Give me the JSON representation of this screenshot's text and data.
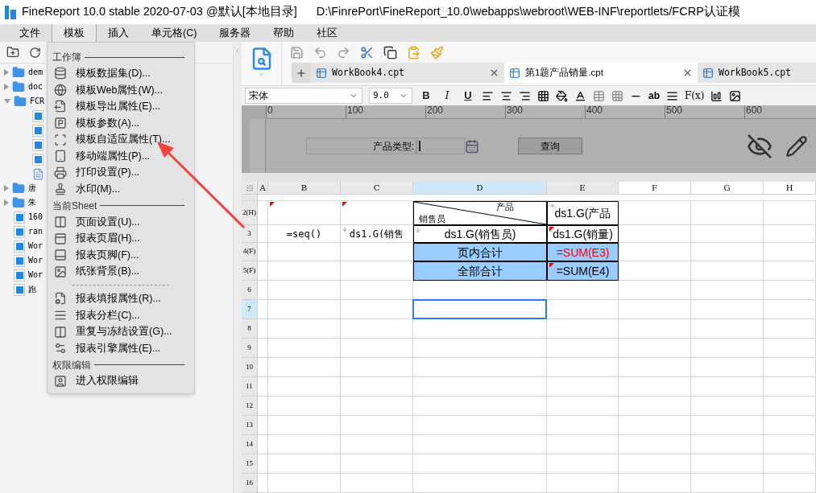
{
  "title_bar": {
    "app_title": "FineReport 10.0 stable 2020-07-03 @默认[本地目录]",
    "path": "D:\\FinrePort\\FineReport_10.0\\webapps\\webroot\\WEB-INF\\reportlets/FCRP认证模"
  },
  "menu_bar": [
    {
      "label": "文件",
      "selected": false
    },
    {
      "label": "模板",
      "selected": true
    },
    {
      "label": "插入",
      "selected": false
    },
    {
      "label": "单元格(C)",
      "selected": false
    },
    {
      "label": "服务器",
      "selected": false
    },
    {
      "label": "帮助",
      "selected": false
    },
    {
      "label": "社区",
      "selected": false
    }
  ],
  "dropdown": {
    "sections": [
      {
        "header": "工作簿",
        "groups": [
          [
            "模板数据集(D)...",
            "模板Web属性(W)...",
            "模板导出属性(E)...",
            "模板参数(A)...",
            "模板自适应属性(T)...",
            "移动端属性(P)...",
            "打印设置(P)...",
            "水印(M)..."
          ]
        ]
      },
      {
        "header": "当前Sheet",
        "groups": [
          [
            "页面设置(U)...",
            "报表页眉(H)...",
            "报表页脚(F)...",
            "纸张背景(B)..."
          ],
          [
            "报表填报属性(R)...",
            "报表分栏(C)...",
            "重复与冻结设置(G)...",
            "报表引擎属性(E)..."
          ]
        ]
      },
      {
        "header": "权限编辑",
        "groups": [
          [
            "进入权限编辑"
          ]
        ]
      }
    ]
  },
  "tree": [
    {
      "label": "dem",
      "kind": "folder",
      "expanded": false
    },
    {
      "label": "doc",
      "kind": "folder",
      "expanded": false
    },
    {
      "label": "FCR",
      "kind": "folder",
      "expanded": true,
      "children": [
        {
          "kind": "report"
        },
        {
          "kind": "report"
        },
        {
          "kind": "report"
        },
        {
          "kind": "report"
        },
        {
          "kind": "form"
        }
      ]
    },
    {
      "label": "唐",
      "kind": "folder",
      "expanded": false
    },
    {
      "label": "朱",
      "kind": "folder",
      "expanded": false
    },
    {
      "label": "160",
      "kind": "report"
    },
    {
      "label": "ran",
      "kind": "report"
    },
    {
      "label": "Wor",
      "kind": "report"
    },
    {
      "label": "Wor",
      "kind": "report"
    },
    {
      "label": "Wor",
      "kind": "report"
    },
    {
      "label": "跑",
      "kind": "report"
    }
  ],
  "tabs": [
    {
      "label": "WorkBook4.cpt",
      "selected": false
    },
    {
      "label": "第1题产品销量.cpt",
      "selected": true
    },
    {
      "label": "WorkBook5.cpt",
      "selected": false
    }
  ],
  "format_bar": {
    "font": "宋体",
    "size": "9.0",
    "style_buttons": [
      "B",
      "I",
      "U"
    ],
    "text_tools": [
      "ab",
      "F(x)"
    ]
  },
  "ruler": [
    "0",
    "100",
    "200",
    "300",
    "400",
    "500",
    "600"
  ],
  "parameter_pane": {
    "label": "产品类型:",
    "button": "查询"
  },
  "sheet": {
    "columns": [
      {
        "name": "A",
        "selected": false
      },
      {
        "name": "B",
        "selected": false
      },
      {
        "name": "C",
        "selected": false
      },
      {
        "name": "D",
        "selected": true
      },
      {
        "name": "E",
        "selected": false
      },
      {
        "name": "F",
        "selected": false
      },
      {
        "name": "G",
        "selected": false
      },
      {
        "name": "H",
        "selected": false
      }
    ],
    "rows": [
      {
        "label": "2(H)",
        "selected": false,
        "cells": [
          {},
          {
            "flag": true
          },
          {
            "flag": true
          },
          {
            "kind": "diagonal",
            "top": "产品",
            "bottom": "销售员",
            "bordered": true
          },
          {
            "kind": "text",
            "text": "ds1.G(产品",
            "bordered": true,
            "expand_right": true
          },
          {},
          {},
          {}
        ]
      },
      {
        "label": "3",
        "selected": false,
        "cells": [
          {},
          {
            "kind": "code",
            "text": "=seq()"
          },
          {
            "kind": "code",
            "text": "ds1.G(销售",
            "expand_down": true
          },
          {
            "kind": "text",
            "text": "ds1.G(销售员)",
            "bordered": true,
            "expand_down": true
          },
          {
            "kind": "text",
            "text": "ds1.G(销量)",
            "bordered": true,
            "flag": true
          },
          {},
          {},
          {}
        ]
      },
      {
        "label": "4(F)",
        "selected": false,
        "cells": [
          {},
          {},
          {},
          {
            "kind": "text",
            "text": "页内合计",
            "bordered": true,
            "highlighted": true
          },
          {
            "kind": "text",
            "text": "=SUM(E3)",
            "bordered": true,
            "highlighted": true,
            "color": "#ff0000"
          },
          {},
          {},
          {}
        ]
      },
      {
        "label": "5(F)",
        "selected": false,
        "cells": [
          {},
          {},
          {},
          {
            "kind": "text",
            "text": "全部合计",
            "bordered": true,
            "highlighted": true
          },
          {
            "kind": "text",
            "text": "=SUM(E4)",
            "bordered": true,
            "highlighted": true,
            "flag": true
          },
          {},
          {},
          {}
        ]
      },
      {
        "label": "6",
        "selected": false
      },
      {
        "label": "7",
        "selected": true
      },
      {
        "label": "8",
        "selected": false
      },
      {
        "label": "9",
        "selected": false
      },
      {
        "label": "10",
        "selected": false
      },
      {
        "label": "11",
        "selected": false
      },
      {
        "label": "12",
        "selected": false
      },
      {
        "label": "13",
        "selected": false
      },
      {
        "label": "14",
        "selected": false
      },
      {
        "label": "15",
        "selected": false
      },
      {
        "label": "16",
        "selected": false
      }
    ]
  }
}
